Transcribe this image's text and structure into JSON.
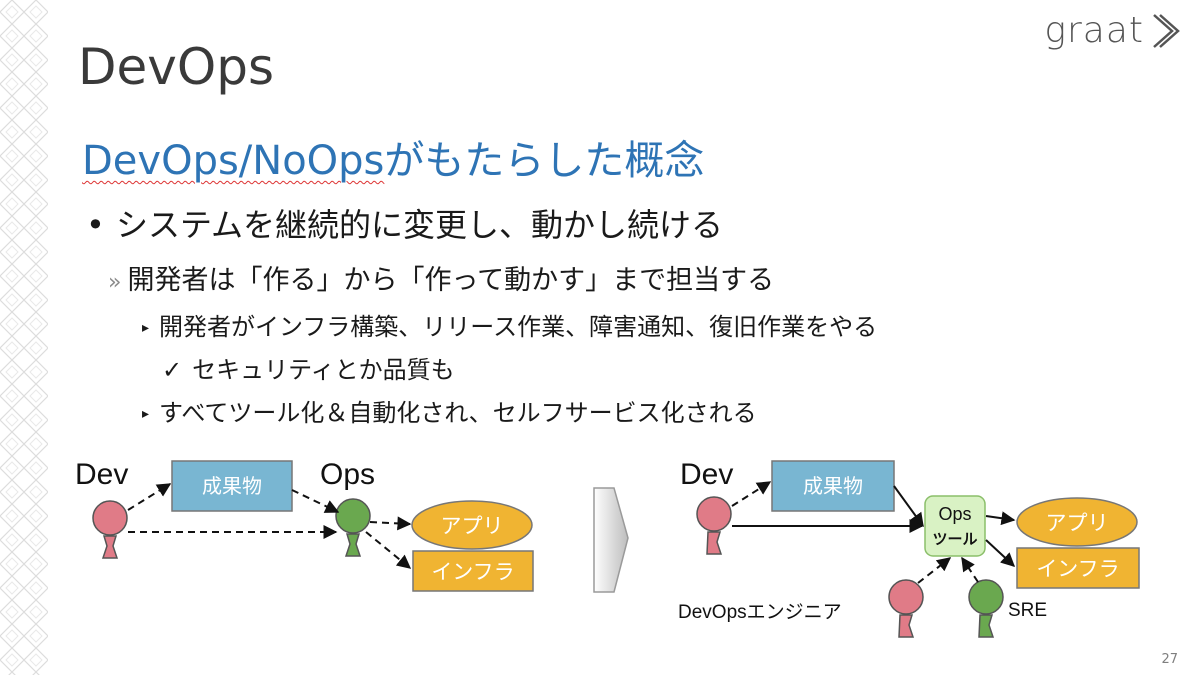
{
  "slide": {
    "title": "DevOps",
    "logo": "graat",
    "subtitle_prefix": "DevOps/NoOps",
    "subtitle_suffix": "がもたらした概念",
    "bullets": {
      "level1": "システムを継続的に変更し、動かし続ける",
      "level2_marker": "»",
      "level2": "開発者は「作る」から「作って動かす」まで担当する",
      "level3_marker": "▸",
      "level3_a": "開発者がインフラ構築、リリース作業、障害通知、復旧作業をやる",
      "level4_marker": "✓",
      "level4": "セキュリティとか品質も",
      "level3_b": "すべてツール化＆自動化され、セルフサービス化される"
    },
    "page_number": "27"
  },
  "diagram": {
    "before": {
      "dev_label": "Dev",
      "ops_label": "Ops",
      "artifact": "成果物",
      "app": "アプリ",
      "infra": "インフラ"
    },
    "after": {
      "dev_label": "Dev",
      "artifact": "成果物",
      "ops_tool_line1": "Ops",
      "ops_tool_line2": "ツール",
      "app": "アプリ",
      "infra": "インフラ",
      "devops_engineer": "DevOpsエンジニア",
      "sre": "SRE"
    },
    "colors": {
      "dev_person": "#e07b87",
      "ops_person": "#6aa84f",
      "artifact_box": "#79b6d2",
      "app_ellipse": "#f0b432",
      "infra_box": "#f0b432",
      "ops_tool_box": "#d9f2c4",
      "subtitle": "#2e74b5"
    }
  }
}
